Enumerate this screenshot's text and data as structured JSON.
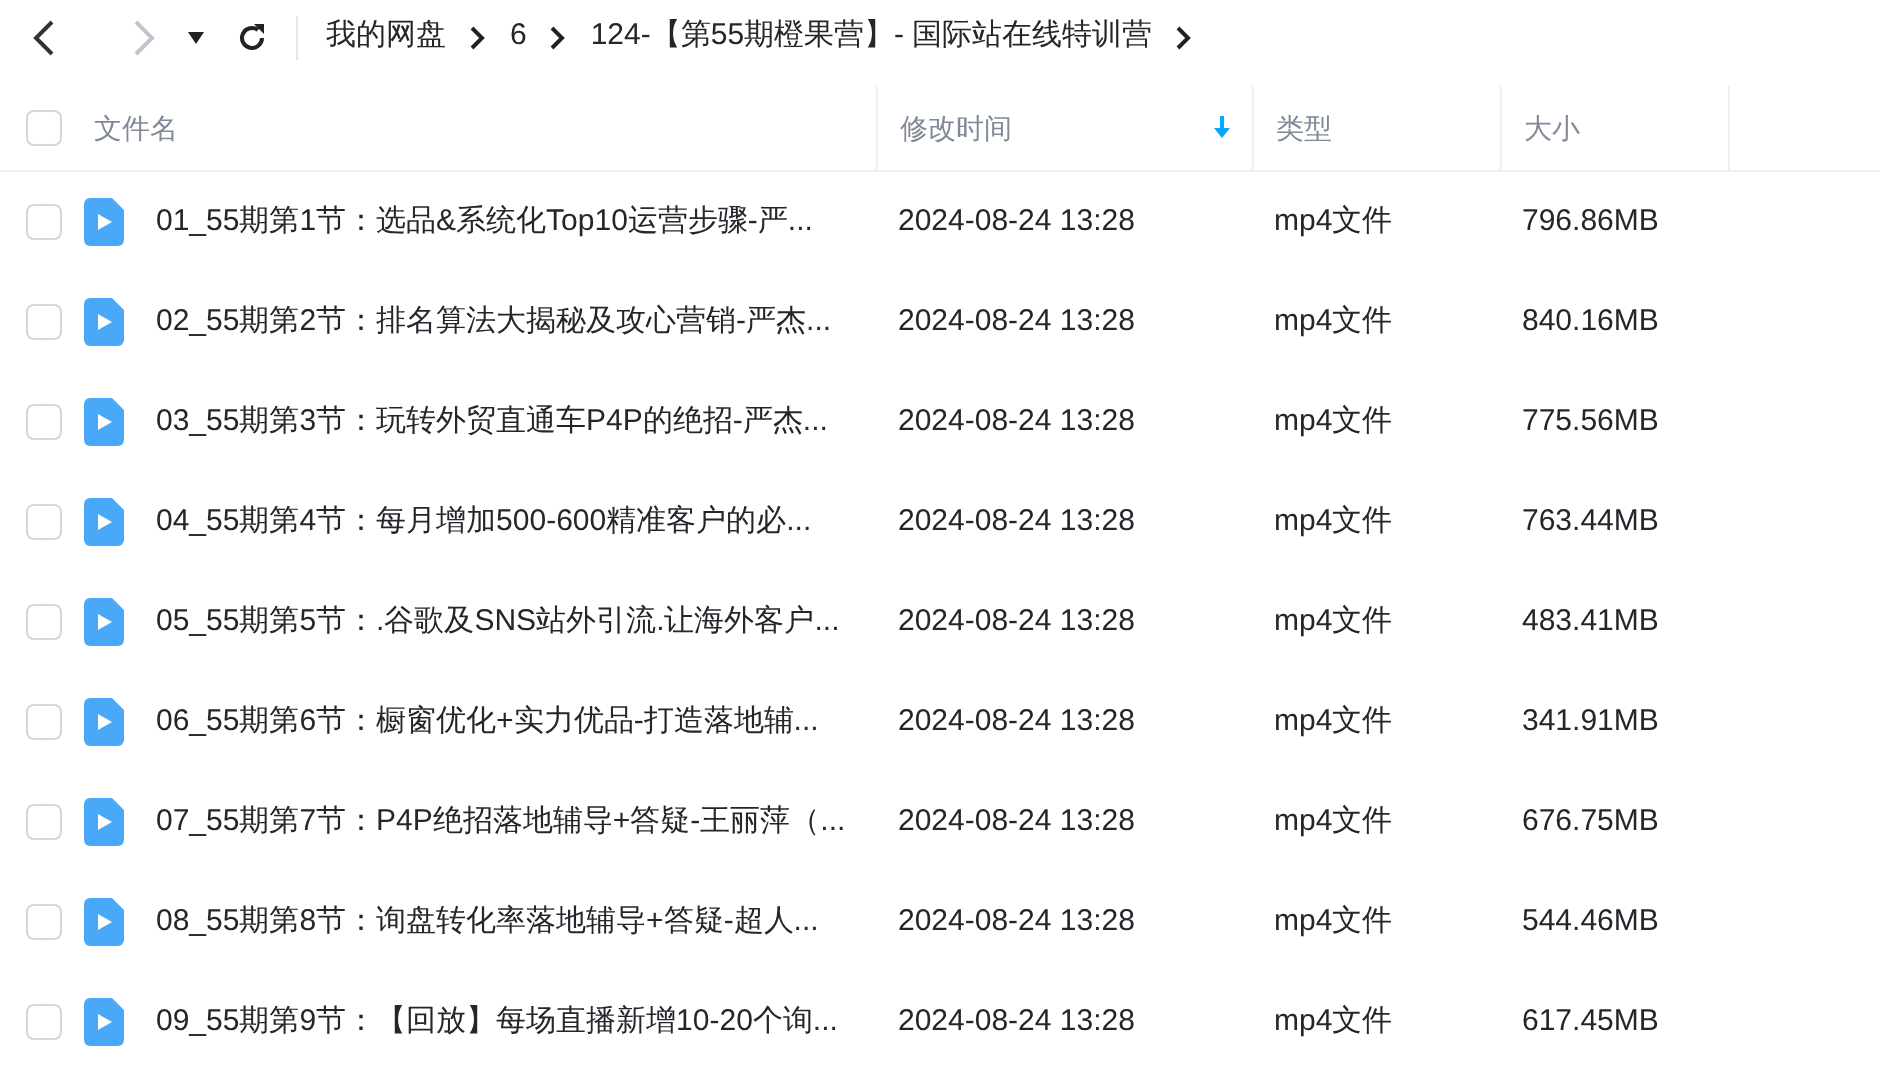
{
  "nav": {
    "back": {
      "disabled": false
    },
    "forward": {
      "disabled": true
    }
  },
  "breadcrumb": [
    "我的网盘",
    "6",
    "124-【第55期橙果营】- 国际站在线特训营"
  ],
  "table": {
    "header_checked": false,
    "columns": [
      {
        "label": "文件名",
        "sorted": false
      },
      {
        "label": "修改时间",
        "sorted": true
      },
      {
        "label": "类型",
        "sorted": false
      },
      {
        "label": "大小",
        "sorted": false
      }
    ],
    "rows": [
      {
        "checked": false,
        "name": "01_55期第1节：选品&系统化Top10运营步骤-严...",
        "modified": "2024-08-24 13:28",
        "type": "mp4文件",
        "size": "796.86MB"
      },
      {
        "checked": false,
        "name": "02_55期第2节：排名算法大揭秘及攻心营销-严杰...",
        "modified": "2024-08-24 13:28",
        "type": "mp4文件",
        "size": "840.16MB"
      },
      {
        "checked": false,
        "name": "03_55期第3节：玩转外贸直通车P4P的绝招-严杰...",
        "modified": "2024-08-24 13:28",
        "type": "mp4文件",
        "size": "775.56MB"
      },
      {
        "checked": false,
        "name": "04_55期第4节：每月增加500-600精准客户的必...",
        "modified": "2024-08-24 13:28",
        "type": "mp4文件",
        "size": "763.44MB"
      },
      {
        "checked": false,
        "name": "05_55期第5节：.谷歌及SNS站外引流.让海外客户...",
        "modified": "2024-08-24 13:28",
        "type": "mp4文件",
        "size": "483.41MB"
      },
      {
        "checked": false,
        "name": "06_55期第6节：橱窗优化+实力优品-打造落地辅...",
        "modified": "2024-08-24 13:28",
        "type": "mp4文件",
        "size": "341.91MB"
      },
      {
        "checked": false,
        "name": "07_55期第7节：P4P绝招落地辅导+答疑-王丽萍（...",
        "modified": "2024-08-24 13:28",
        "type": "mp4文件",
        "size": "676.75MB"
      },
      {
        "checked": false,
        "name": "08_55期第8节：询盘转化率落地辅导+答疑-超人...",
        "modified": "2024-08-24 13:28",
        "type": "mp4文件",
        "size": "544.46MB"
      },
      {
        "checked": false,
        "name": "09_55期第9节：【回放】每场直播新增10-20个询...",
        "modified": "2024-08-24 13:28",
        "type": "mp4文件",
        "size": "617.45MB"
      }
    ]
  }
}
